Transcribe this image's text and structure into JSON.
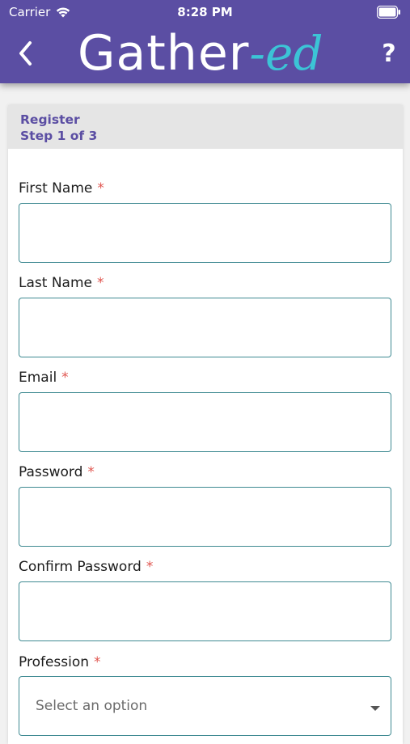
{
  "status_bar": {
    "carrier": "Carrier",
    "time": "8:28 PM"
  },
  "header": {
    "logo_main": "Gather",
    "logo_accent": "-ed",
    "help_label": "?"
  },
  "form": {
    "title": "Register",
    "step": "Step 1 of 3",
    "required_marker": "*",
    "fields": [
      {
        "label": "First Name",
        "value": ""
      },
      {
        "label": "Last Name",
        "value": ""
      },
      {
        "label": "Email",
        "value": ""
      },
      {
        "label": "Password",
        "value": ""
      },
      {
        "label": "Confirm Password",
        "value": ""
      },
      {
        "label": "Profession",
        "placeholder": "Select an option"
      }
    ]
  },
  "colors": {
    "header": "#5b4ea3",
    "accent": "#3cc4d6",
    "input_border": "#3f8a92",
    "required": "#e0554f"
  },
  "icons": [
    "back-chevron-icon",
    "wifi-icon",
    "battery-icon",
    "chevron-down-icon"
  ]
}
